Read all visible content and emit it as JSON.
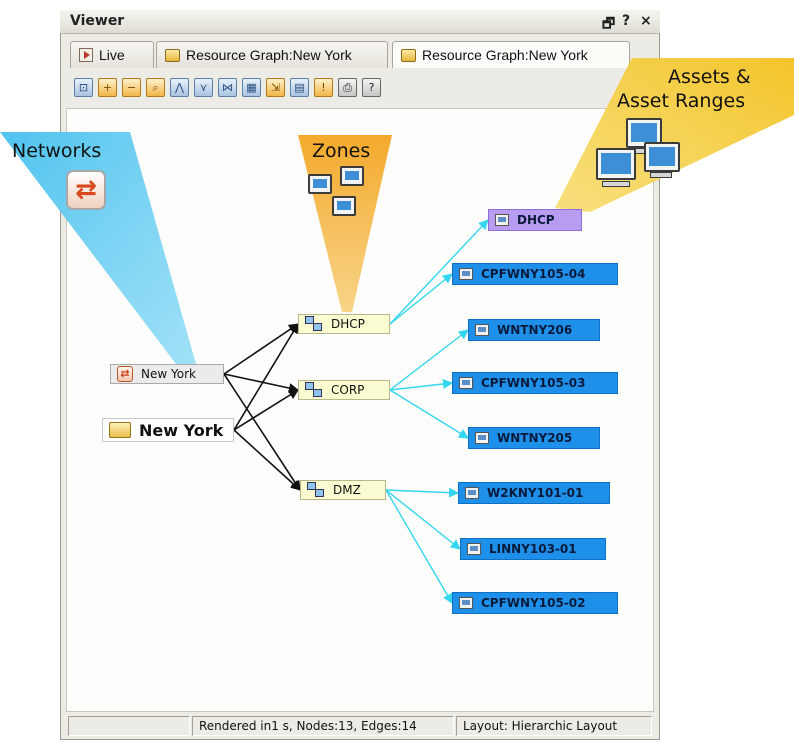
{
  "window": {
    "title": "Viewer",
    "controls": {
      "undock": "🗗",
      "help": "?",
      "close": "×"
    }
  },
  "tabs": [
    {
      "label": "Live",
      "icon": "live-icon",
      "active": false
    },
    {
      "label": "Resource Graph:New York",
      "icon": "folder-icon",
      "active": false
    },
    {
      "label": "Resource Graph:New York",
      "icon": "folder-icon",
      "active": true
    }
  ],
  "toolbar": {
    "buttons": [
      {
        "icon": "fit-view-icon",
        "glyph": "⊡"
      },
      {
        "icon": "zoom-in-icon",
        "glyph": "+"
      },
      {
        "icon": "zoom-out-icon",
        "glyph": "−"
      },
      {
        "icon": "zoom-area-icon",
        "glyph": "⌕"
      },
      {
        "icon": "hierarchic-layout-icon",
        "glyph": "⋀"
      },
      {
        "icon": "tree-layout-icon",
        "glyph": "⋎"
      },
      {
        "icon": "organic-layout-icon",
        "glyph": "⋈"
      },
      {
        "icon": "grid-layout-icon",
        "glyph": "▦"
      },
      {
        "icon": "export-icon",
        "glyph": "⇲"
      },
      {
        "icon": "settings-icon",
        "glyph": "▤"
      },
      {
        "icon": "alert-icon",
        "glyph": "!"
      },
      {
        "icon": "print-icon",
        "glyph": "⎙"
      },
      {
        "icon": "help-icon",
        "glyph": "?"
      }
    ]
  },
  "callouts": {
    "networks": "Networks",
    "zones": "Zones",
    "assets_line1": "Assets &",
    "assets_line2": "Asset Ranges"
  },
  "graph": {
    "networks": [
      {
        "id": "net-newyork",
        "label": "New York"
      }
    ],
    "sites": [
      {
        "id": "site-newyork",
        "label": "New York"
      }
    ],
    "zones": [
      {
        "id": "zone-dhcp",
        "label": "DHCP"
      },
      {
        "id": "zone-corp",
        "label": "CORP"
      },
      {
        "id": "zone-dmz",
        "label": "DMZ"
      }
    ],
    "assets": [
      {
        "id": "a-dhcp",
        "label": "DHCP",
        "kind": "range"
      },
      {
        "id": "a-cpf04",
        "label": "CPFWNY105-04",
        "kind": "asset"
      },
      {
        "id": "a-wnt206",
        "label": "WNTNY206",
        "kind": "asset"
      },
      {
        "id": "a-cpf03",
        "label": "CPFWNY105-03",
        "kind": "asset"
      },
      {
        "id": "a-wnt205",
        "label": "WNTNY205",
        "kind": "asset"
      },
      {
        "id": "a-w2k",
        "label": "W2KNY101-01",
        "kind": "asset"
      },
      {
        "id": "a-linny",
        "label": "LINNY103-01",
        "kind": "asset"
      },
      {
        "id": "a-cpf02",
        "label": "CPFWNY105-02",
        "kind": "asset"
      }
    ],
    "edges": [
      {
        "from": "net-newyork",
        "to": "zone-dhcp",
        "style": "black"
      },
      {
        "from": "net-newyork",
        "to": "zone-corp",
        "style": "black"
      },
      {
        "from": "net-newyork",
        "to": "zone-dmz",
        "style": "black"
      },
      {
        "from": "site-newyork",
        "to": "zone-dhcp",
        "style": "black"
      },
      {
        "from": "site-newyork",
        "to": "zone-corp",
        "style": "black"
      },
      {
        "from": "site-newyork",
        "to": "zone-dmz",
        "style": "black"
      },
      {
        "from": "zone-dhcp",
        "to": "a-dhcp",
        "style": "cyan"
      },
      {
        "from": "zone-dhcp",
        "to": "a-cpf04",
        "style": "cyan"
      },
      {
        "from": "zone-corp",
        "to": "a-wnt206",
        "style": "cyan"
      },
      {
        "from": "zone-corp",
        "to": "a-cpf03",
        "style": "cyan"
      },
      {
        "from": "zone-corp",
        "to": "a-wnt205",
        "style": "cyan"
      },
      {
        "from": "zone-dmz",
        "to": "a-w2k",
        "style": "cyan"
      },
      {
        "from": "zone-dmz",
        "to": "a-linny",
        "style": "cyan"
      },
      {
        "from": "zone-dmz",
        "to": "a-cpf02",
        "style": "cyan"
      }
    ]
  },
  "status": {
    "left": "",
    "middle": "Rendered in1 s, Nodes:13, Edges:14",
    "right": "Layout: Hierarchic Layout"
  },
  "colors": {
    "asset_fill": "#1e90ea",
    "range_fill": "#b79cf2",
    "zone_fill": "#fbfbd2",
    "edge_black": "#111111",
    "edge_cyan": "#33d6ee",
    "callout_blue": "#5cc8f0",
    "callout_orange": "#f2b23a",
    "callout_yellow": "#f5cf3e"
  }
}
